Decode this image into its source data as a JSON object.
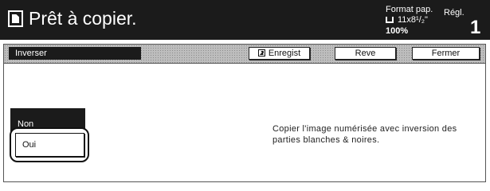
{
  "header": {
    "title": "Prêt à copier.",
    "format_label": "Format pap.",
    "paper_size": "11x8¹/₂\"",
    "zoom": "100%",
    "regl_label": "Régl.",
    "copies": "1",
    "icons": [
      "copy-icon",
      "paper-tray-icon"
    ]
  },
  "toolbar": {
    "title": "Inverser",
    "enregist_label": "Enregist",
    "reve_label": "Reve",
    "fermer_label": "Fermer"
  },
  "options": {
    "non_label": "Non",
    "oui_label": "Oui",
    "selected": "Oui"
  },
  "description": "Copier l'image numérisée avec inversion des parties blanches & noires.",
  "colors": {
    "header_bg": "#1b1b1b",
    "toolbar_bg": "#bdbdbd",
    "selected_bg": "#1b1b1b"
  }
}
